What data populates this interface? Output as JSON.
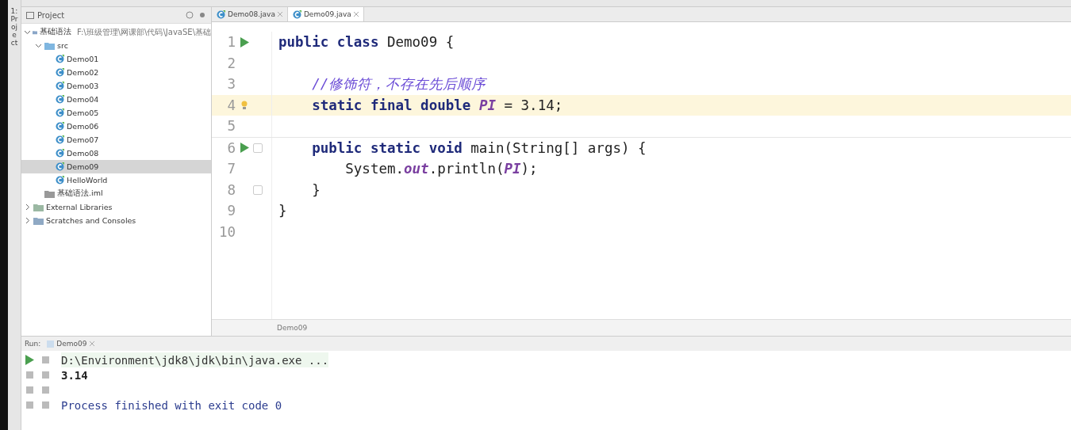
{
  "side_strip": {
    "label": "1: Project"
  },
  "project_panel": {
    "title": "Project",
    "tree": [
      {
        "label": "基础语法",
        "path": "F:\\班级管理\\网课部\\代码\\JavaSE\\基础",
        "kind": "module",
        "expanded": true,
        "selected": false,
        "children": [
          {
            "label": "src",
            "kind": "folder",
            "expanded": true,
            "selected": false,
            "children": [
              {
                "label": "Demo01",
                "kind": "class",
                "selected": false
              },
              {
                "label": "Demo02",
                "kind": "class",
                "selected": false
              },
              {
                "label": "Demo03",
                "kind": "class",
                "selected": false
              },
              {
                "label": "Demo04",
                "kind": "class",
                "selected": false
              },
              {
                "label": "Demo05",
                "kind": "class",
                "selected": false
              },
              {
                "label": "Demo06",
                "kind": "class",
                "selected": false
              },
              {
                "label": "Demo07",
                "kind": "class",
                "selected": false
              },
              {
                "label": "Demo08",
                "kind": "class",
                "selected": false
              },
              {
                "label": "Demo09",
                "kind": "class",
                "selected": true
              },
              {
                "label": "HelloWorld",
                "kind": "class",
                "selected": false
              }
            ]
          },
          {
            "label": "基础语法.iml",
            "kind": "file",
            "selected": false
          }
        ]
      },
      {
        "label": "External Libraries",
        "kind": "library",
        "expanded": false,
        "selected": false
      },
      {
        "label": "Scratches and Consoles",
        "kind": "scratch",
        "expanded": false,
        "selected": false
      }
    ]
  },
  "editor": {
    "tabs": [
      {
        "label": "Demo08.java",
        "selected": false
      },
      {
        "label": "Demo09.java",
        "selected": true
      }
    ],
    "lines": [
      {
        "number": "1",
        "run": true,
        "current": false,
        "tokens": [
          {
            "text": "public class ",
            "kind": "keyword"
          },
          {
            "text": "Demo09 {",
            "kind": "plain"
          }
        ]
      },
      {
        "number": "2",
        "run": false,
        "current": false
      },
      {
        "number": "3",
        "run": false,
        "current": false,
        "tokens": [
          {
            "text": "    //修饰符，不存在先后顺序",
            "kind": "comment"
          }
        ]
      },
      {
        "number": "4",
        "run": false,
        "current": true,
        "bulb": true,
        "tokens": [
          {
            "text": "    static final double ",
            "kind": "keyword"
          },
          {
            "text": "PI",
            "kind": "constant"
          },
          {
            "text": " = 3.14;",
            "kind": "plain"
          }
        ]
      },
      {
        "number": "5",
        "run": false,
        "current": false
      },
      {
        "number": "6",
        "run": true,
        "current": false,
        "fold": true,
        "tokens": [
          {
            "text": "    public static void ",
            "kind": "keyword"
          },
          {
            "text": "main(String[] args) {",
            "kind": "plain"
          }
        ]
      },
      {
        "number": "7",
        "run": false,
        "current": false,
        "tokens": [
          {
            "text": "        System.",
            "kind": "plain"
          },
          {
            "text": "out",
            "kind": "field"
          },
          {
            "text": ".println(",
            "kind": "plain"
          },
          {
            "text": "PI",
            "kind": "constant"
          },
          {
            "text": ");",
            "kind": "plain"
          }
        ]
      },
      {
        "number": "8",
        "run": false,
        "current": false,
        "fold": true,
        "tokens": [
          {
            "text": "    }",
            "kind": "plain"
          }
        ]
      },
      {
        "number": "9",
        "run": false,
        "current": false,
        "tokens": [
          {
            "text": "}",
            "kind": "plain"
          }
        ]
      },
      {
        "number": "10",
        "run": false,
        "current": false
      }
    ],
    "breadcrumb": "Demo09"
  },
  "run_panel": {
    "label": "Run:",
    "tab": "Demo09",
    "output": [
      {
        "text": "D:\\Environment\\jdk8\\jdk\\bin\\java.exe ...",
        "kind": "command"
      },
      {
        "text": "3.14",
        "kind": "stdout"
      },
      {
        "text": "Process finished with exit code 0",
        "kind": "system"
      }
    ]
  }
}
